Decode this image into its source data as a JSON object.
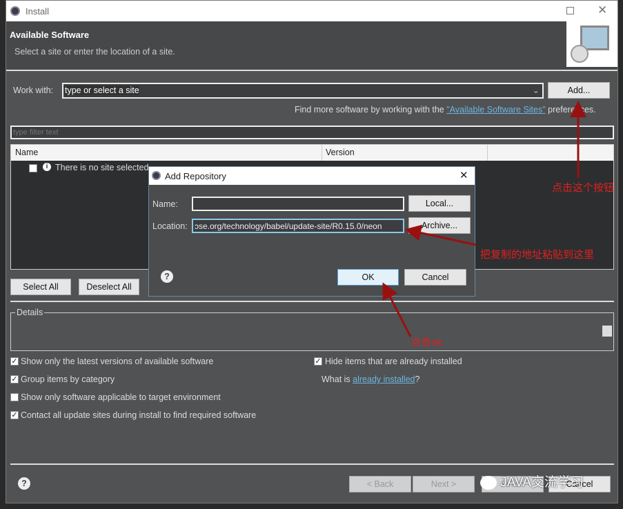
{
  "window": {
    "title": "Install",
    "maximize_icon": "maximize-icon",
    "close_icon": "close-icon"
  },
  "header": {
    "title": "Available Software",
    "subtitle": "Select a site or enter the location of a site."
  },
  "work_with": {
    "label": "Work with:",
    "value": "type or select a site",
    "add_label": "Add..."
  },
  "find_more": {
    "prefix": "Find more software by working with the ",
    "link": "\"Available Software Sites\"",
    "suffix": " preferences."
  },
  "filter": {
    "placeholder": "type filter text"
  },
  "table": {
    "columns": [
      "Name",
      "Version"
    ],
    "rows": [
      {
        "name": "There is no site selected."
      }
    ]
  },
  "buttons": {
    "select_all": "Select All",
    "deselect_all": "Deselect All"
  },
  "details": {
    "label": "Details"
  },
  "options": [
    {
      "label": "Show only the latest versions of available software",
      "checked": true
    },
    {
      "label": "Group items by category",
      "checked": true
    },
    {
      "label": "Show only software applicable to target environment",
      "checked": false
    },
    {
      "label": "Contact all update sites during install to find required software",
      "checked": true
    },
    {
      "label": "Hide items that are already installed",
      "checked": true
    }
  ],
  "what_is": {
    "prefix": "What is ",
    "link": "already installed",
    "suffix": "?"
  },
  "footer": {
    "back": "< Back",
    "next": "Next >",
    "finish": "Finish",
    "cancel": "Cancel"
  },
  "dialog": {
    "title": "Add Repository",
    "name_label": "Name:",
    "name_value": "",
    "location_label": "Location:",
    "location_value": "ɔse.org/technology/babel/update-site/R0.15.0/neon",
    "local_label": "Local...",
    "archive_label": "Archive...",
    "ok_label": "OK",
    "cancel_label": "Cancel"
  },
  "annotations": {
    "click_button": "点击这个按钮",
    "paste_here": "把复制的地址粘贴到这里",
    "click_ok": "点击ok",
    "color": "#e02020"
  },
  "watermark": {
    "text": "JAVA交流学习"
  }
}
